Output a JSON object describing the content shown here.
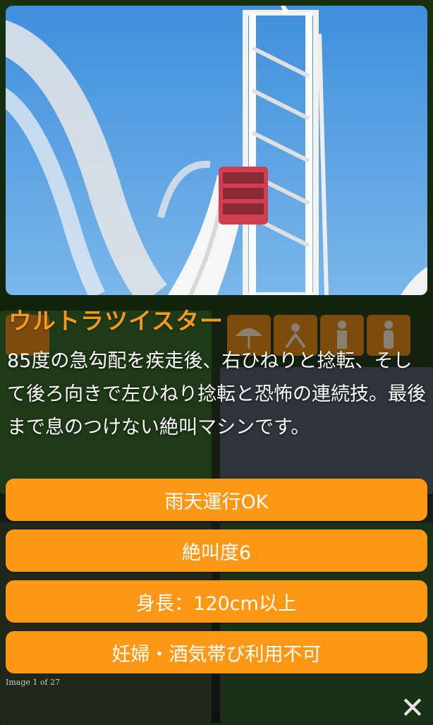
{
  "ride": {
    "title": "ウルトラツイスター",
    "description": "85度の急勾配を疾走後、右ひねりと捻転、そして後ろ向きで左ひねり捻転と恐怖の連続技。最後まで息のつけない絶叫マシンです。",
    "photo_icon": "roller-coaster-photo"
  },
  "tags": [
    "雨天運行OK",
    "絶叫度6",
    "身長：120cm以上",
    "妊婦・酒気帯び利用不可"
  ],
  "gallery": {
    "counter": "Image 1 of 27",
    "close_glyph": "✕",
    "close_icon": "close-icon"
  },
  "colors": {
    "accent": "#fd9714",
    "title": "#f39a1b",
    "sky": "#4f9be0"
  }
}
